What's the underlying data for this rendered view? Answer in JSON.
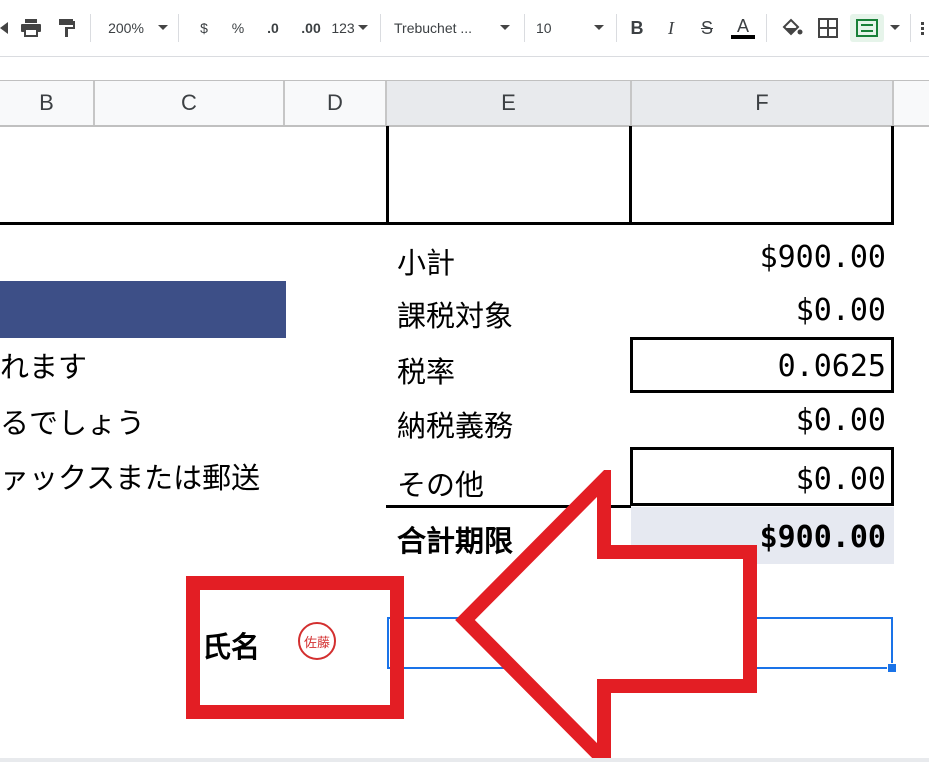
{
  "toolbar": {
    "zoom": "200%",
    "currency": "$",
    "percent": "%",
    "dec_decrease": ".0",
    "dec_increase": ".00",
    "more_formats": "123",
    "font": "Trebuchet ...",
    "font_size": "10",
    "bold": "B",
    "italic": "I",
    "strike": "S",
    "text_color": "A"
  },
  "columns": [
    "B",
    "C",
    "D",
    "E",
    "F"
  ],
  "left_text": {
    "line1": "れます",
    "line2": "るでしょう",
    "line3": "ァックスまたは郵送"
  },
  "summary": [
    {
      "label": "小計",
      "value": "$900.00"
    },
    {
      "label": "課税対象",
      "value": "$0.00"
    },
    {
      "label": "税率",
      "value": "0.0625"
    },
    {
      "label": "納税義務",
      "value": "$0.00"
    },
    {
      "label": "その他",
      "value": "$0.00"
    }
  ],
  "total": {
    "label": "合計期限",
    "value": "$900.00"
  },
  "name_label": "氏名",
  "seal_text": "佐藤",
  "colors": {
    "accent_blue": "#3d4f87",
    "annotation_red": "#e31e24",
    "selection_blue": "#1a73e8",
    "total_bg": "#e6e9f1"
  }
}
